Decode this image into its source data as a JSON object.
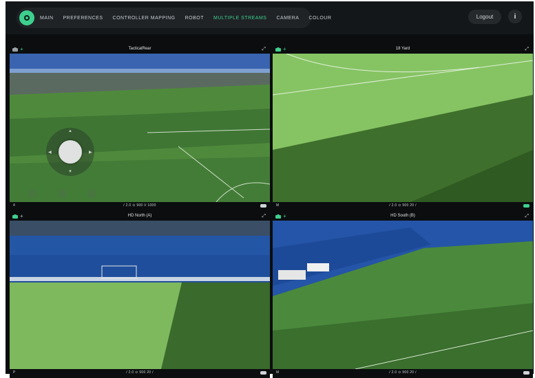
{
  "nav": {
    "items": [
      "MAIN",
      "PREFERENCES",
      "CONTROLLER MAPPING",
      "ROBOT",
      "MULTIPLE STREAMS",
      "CAMERA",
      "COLOUR"
    ],
    "active_index": 4,
    "logout_label": "Logout",
    "info_label": "i"
  },
  "panels": [
    {
      "title": "TacticalRear",
      "footer_left": "4",
      "stats": "/ 2.0    ⊙ 900    I/ 1000",
      "plus_color": "#3ecf8e",
      "cam_color": "#9aa0a5",
      "gamepad_color": "#d0d3d6",
      "has_joystick": true
    },
    {
      "title": "18 Yard",
      "footer_left": "M",
      "stats": "/ 2.0    ⊙ 900    20 /",
      "plus_color": "#3ecf8e",
      "cam_color": "#3ecf8e",
      "gamepad_color": "#3ecf8e",
      "has_joystick": false
    },
    {
      "title": "HD North (A)",
      "footer_left": "P",
      "stats": "/ 2.0    ⊙ 900    20 /",
      "plus_color": "#b8bdc1",
      "cam_color": "#3ecf8e",
      "gamepad_color": "#d0d3d6",
      "has_joystick": false
    },
    {
      "title": "HD South (B)",
      "footer_left": "M",
      "stats": "/ 2.0    ⊙ 900    20 /",
      "plus_color": "#3ecf8e",
      "cam_color": "#3ecf8e",
      "gamepad_color": "#d0d3d6",
      "has_joystick": false
    }
  ],
  "icons": {
    "logo": "app-logo-icon",
    "camera": "camera-icon",
    "plus": "plus-icon",
    "expand": "expand-icon",
    "gamepad": "gamepad-icon",
    "play": "play-icon",
    "pause": "pause-icon",
    "stop": "stop-icon"
  },
  "colors": {
    "accent": "#3ecf8e",
    "background": "#0b0d0f",
    "topbar": "#141719"
  }
}
